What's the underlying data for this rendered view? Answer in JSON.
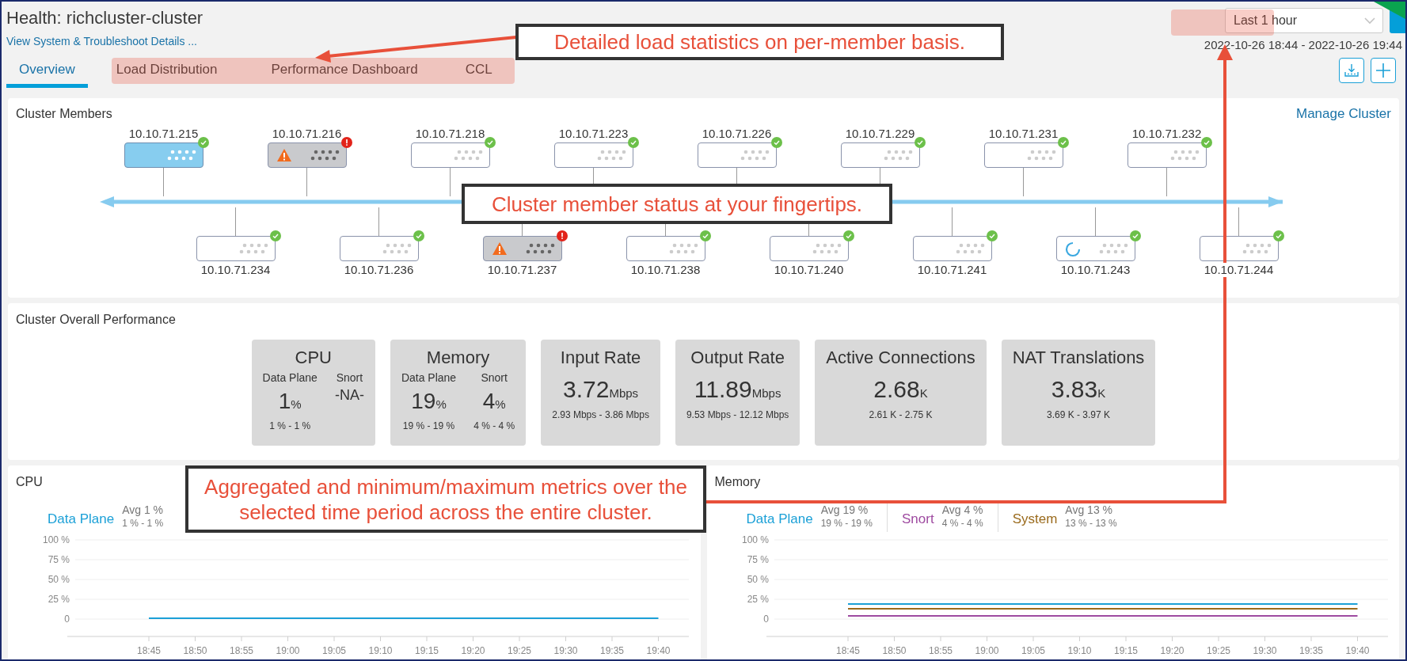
{
  "header": {
    "title": "Health: richcluster-cluster",
    "details_link": "View System & Troubleshoot Details ...",
    "tabs": [
      {
        "label": "Overview",
        "selected": true
      },
      {
        "label": "Load Distribution",
        "selected": false
      },
      {
        "label": "Performance Dashboard",
        "selected": false
      },
      {
        "label": "CCL",
        "selected": false
      }
    ],
    "time_range": "Last 1 hour",
    "date_range": "2022-10-26 18:44 - 2022-10-26 19:44"
  },
  "cluster_members": {
    "title": "Cluster Members",
    "manage_link": "Manage Cluster",
    "top_row": [
      {
        "ip": "10.10.71.215",
        "kind": "control",
        "alert": false
      },
      {
        "ip": "10.10.71.216",
        "kind": "warning",
        "alert": true
      },
      {
        "ip": "10.10.71.218",
        "kind": "normal",
        "alert": false
      },
      {
        "ip": "10.10.71.223",
        "kind": "normal",
        "alert": false
      },
      {
        "ip": "10.10.71.226",
        "kind": "normal",
        "alert": false
      },
      {
        "ip": "10.10.71.229",
        "kind": "normal",
        "alert": false
      },
      {
        "ip": "10.10.71.231",
        "kind": "normal",
        "alert": false
      },
      {
        "ip": "10.10.71.232",
        "kind": "normal",
        "alert": false
      }
    ],
    "bottom_row": [
      {
        "ip": "10.10.71.234",
        "kind": "normal",
        "alert": false
      },
      {
        "ip": "10.10.71.236",
        "kind": "normal",
        "alert": false
      },
      {
        "ip": "10.10.71.237",
        "kind": "warning",
        "alert": true
      },
      {
        "ip": "10.10.71.238",
        "kind": "normal",
        "alert": false
      },
      {
        "ip": "10.10.71.240",
        "kind": "normal",
        "alert": false
      },
      {
        "ip": "10.10.71.241",
        "kind": "normal",
        "alert": false
      },
      {
        "ip": "10.10.71.243",
        "kind": "joining",
        "alert": false
      },
      {
        "ip": "10.10.71.244",
        "kind": "normal",
        "alert": false
      }
    ]
  },
  "overall_performance": {
    "title": "Cluster Overall Performance",
    "cards": [
      {
        "kind": "split",
        "title": "CPU",
        "metrics": [
          {
            "label": "Data Plane",
            "value": "1",
            "unit": "%",
            "range": "1 % - 1 %"
          },
          {
            "label": "Snort",
            "value": "-NA-"
          }
        ]
      },
      {
        "kind": "split",
        "title": "Memory",
        "metrics": [
          {
            "label": "Data Plane",
            "value": "19",
            "unit": "%",
            "range": "19 % - 19 %"
          },
          {
            "label": "Snort",
            "value": "4",
            "unit": "%",
            "range": "4 % - 4 %"
          }
        ]
      },
      {
        "kind": "single",
        "title": "Input Rate",
        "value": "3.72",
        "unit": "Mbps",
        "range": "2.93 Mbps - 3.86 Mbps"
      },
      {
        "kind": "single",
        "title": "Output Rate",
        "value": "11.89",
        "unit": "Mbps",
        "range": "9.53 Mbps - 12.12 Mbps"
      },
      {
        "kind": "single",
        "title": "Active Connections",
        "value": "2.68",
        "unit": "K",
        "range": "2.61 K - 2.75 K"
      },
      {
        "kind": "single",
        "title": "NAT Translations",
        "value": "3.83",
        "unit": "K",
        "range": "3.69 K - 3.97 K"
      }
    ]
  },
  "charts": [
    {
      "title": "CPU",
      "legend": [
        {
          "avg": "Avg 1 %",
          "range": "1 % - 1 %"
        }
      ],
      "chart_data": {
        "type": "line",
        "categories": [
          "18:45",
          "18:50",
          "18:55",
          "19:00",
          "19:05",
          "19:10",
          "19:15",
          "19:20",
          "19:25",
          "19:30",
          "19:35",
          "19:40"
        ],
        "yticks": [
          {
            "value": 0,
            "label": "0"
          },
          {
            "value": 25,
            "label": "25 %"
          },
          {
            "value": 50,
            "label": "50 %"
          },
          {
            "value": 75,
            "label": "75 %"
          },
          {
            "value": 100,
            "label": "100 %"
          }
        ],
        "ylim": [
          0,
          100
        ],
        "grid": true,
        "series": [
          {
            "name": "Data Plane",
            "color": "#1ba0d7",
            "values": [
              1,
              1,
              1,
              1,
              1,
              1,
              1,
              1,
              1,
              1,
              1,
              1
            ]
          }
        ]
      }
    },
    {
      "title": "Memory",
      "legend": [
        {
          "avg": "Avg 19 %",
          "range": "19 % - 19 %"
        },
        {
          "avg": "Avg 4 %",
          "range": "4 % - 4 %"
        },
        {
          "avg": "Avg 13 %",
          "range": "13 % - 13 %"
        }
      ],
      "chart_data": {
        "type": "line",
        "categories": [
          "18:45",
          "18:50",
          "18:55",
          "19:00",
          "19:05",
          "19:10",
          "19:15",
          "19:20",
          "19:25",
          "19:30",
          "19:35",
          "19:40"
        ],
        "yticks": [
          {
            "value": 0,
            "label": "0"
          },
          {
            "value": 25,
            "label": "25 %"
          },
          {
            "value": 50,
            "label": "50 %"
          },
          {
            "value": 75,
            "label": "75 %"
          },
          {
            "value": 100,
            "label": "100 %"
          }
        ],
        "ylim": [
          0,
          100
        ],
        "grid": true,
        "series": [
          {
            "name": "Data Plane",
            "color": "#1ba0d7",
            "values": [
              19,
              19,
              19,
              19,
              19,
              19,
              19,
              19,
              19,
              19,
              19,
              19
            ]
          },
          {
            "name": "Snort",
            "color": "#9e4aa0",
            "values": [
              4,
              4,
              4,
              4,
              4,
              4,
              4,
              4,
              4,
              4,
              4,
              4
            ]
          },
          {
            "name": "System",
            "color": "#9a6a1c",
            "values": [
              13,
              13,
              13,
              13,
              13,
              13,
              13,
              13,
              13,
              13,
              13,
              13
            ]
          }
        ]
      }
    }
  ],
  "annotations": [
    {
      "text": "Detailed load statistics on per-member basis."
    },
    {
      "text": "Cluster member status at your fingertips."
    },
    {
      "text": "Aggregated and minimum/maximum metrics over the selected time period across the entire cluster."
    }
  ]
}
